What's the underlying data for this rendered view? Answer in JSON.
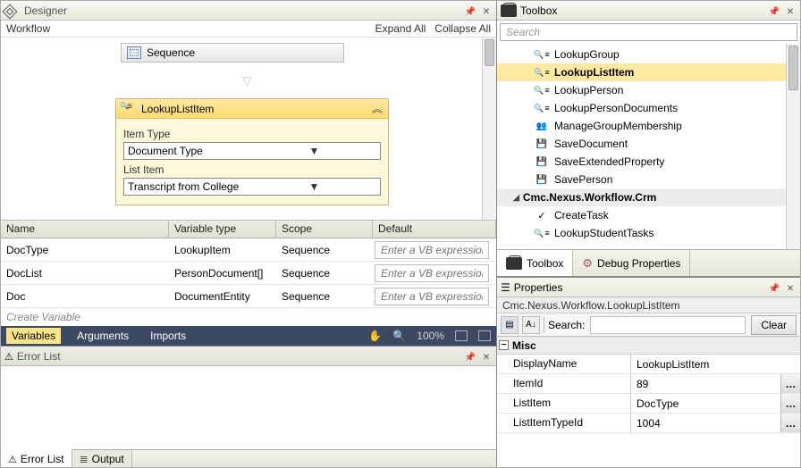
{
  "designer": {
    "title": "Designer",
    "workflow_label": "Workflow",
    "expand_all": "Expand All",
    "collapse_all": "Collapse All",
    "sequence_label": "Sequence",
    "activity": {
      "title": "LookupListItem",
      "fields": [
        {
          "label": "Item Type",
          "value": "Document Type"
        },
        {
          "label": "List Item",
          "value": "Transcript from College"
        }
      ]
    }
  },
  "variables": {
    "headers": {
      "name": "Name",
      "type": "Variable type",
      "scope": "Scope",
      "default": "Default"
    },
    "placeholder": "Enter a VB expression",
    "rows": [
      {
        "name": "DocType",
        "type": "LookupItem",
        "scope": "Sequence"
      },
      {
        "name": "DocList",
        "type": "PersonDocument[]",
        "scope": "Sequence"
      },
      {
        "name": "Doc",
        "type": "DocumentEntity",
        "scope": "Sequence"
      }
    ],
    "create": "Create Variable",
    "footer": {
      "variables": "Variables",
      "arguments": "Arguments",
      "imports": "Imports",
      "zoom": "100%"
    }
  },
  "errorlist": {
    "title": "Error List",
    "tab_error": "Error List",
    "tab_output": "Output"
  },
  "toolbox": {
    "title": "Toolbox",
    "search_placeholder": "Search",
    "items": [
      {
        "label": "LookupGroup",
        "icon": "ico-look"
      },
      {
        "label": "LookupListItem",
        "icon": "ico-look",
        "selected": true,
        "bold": true
      },
      {
        "label": "LookupPerson",
        "icon": "ico-look"
      },
      {
        "label": "LookupPersonDocuments",
        "icon": "ico-look"
      },
      {
        "label": "ManageGroupMembership",
        "icon": "ico-people"
      },
      {
        "label": "SaveDocument",
        "icon": "ico-save"
      },
      {
        "label": "SaveExtendedProperty",
        "icon": "ico-save"
      },
      {
        "label": "SavePerson",
        "icon": "ico-save"
      }
    ],
    "category": "Cmc.Nexus.Workflow.Crm",
    "cat_items": [
      {
        "label": "CreateTask",
        "icon": "ico-check"
      },
      {
        "label": "LookupStudentTasks",
        "icon": "ico-look"
      }
    ],
    "tab_toolbox": "Toolbox",
    "tab_debug": "Debug Properties"
  },
  "properties": {
    "title": "Properties",
    "context": "Cmc.Nexus.Workflow.LookupListItem",
    "search_label": "Search:",
    "clear": "Clear",
    "category": "Misc",
    "rows": [
      {
        "name": "DisplayName",
        "value": "LookupListItem",
        "ellipsis": false
      },
      {
        "name": "ItemId",
        "value": "89",
        "ellipsis": true
      },
      {
        "name": "ListItem",
        "value": "DocType",
        "ellipsis": true
      },
      {
        "name": "ListItemTypeId",
        "value": "1004",
        "ellipsis": true
      }
    ]
  }
}
